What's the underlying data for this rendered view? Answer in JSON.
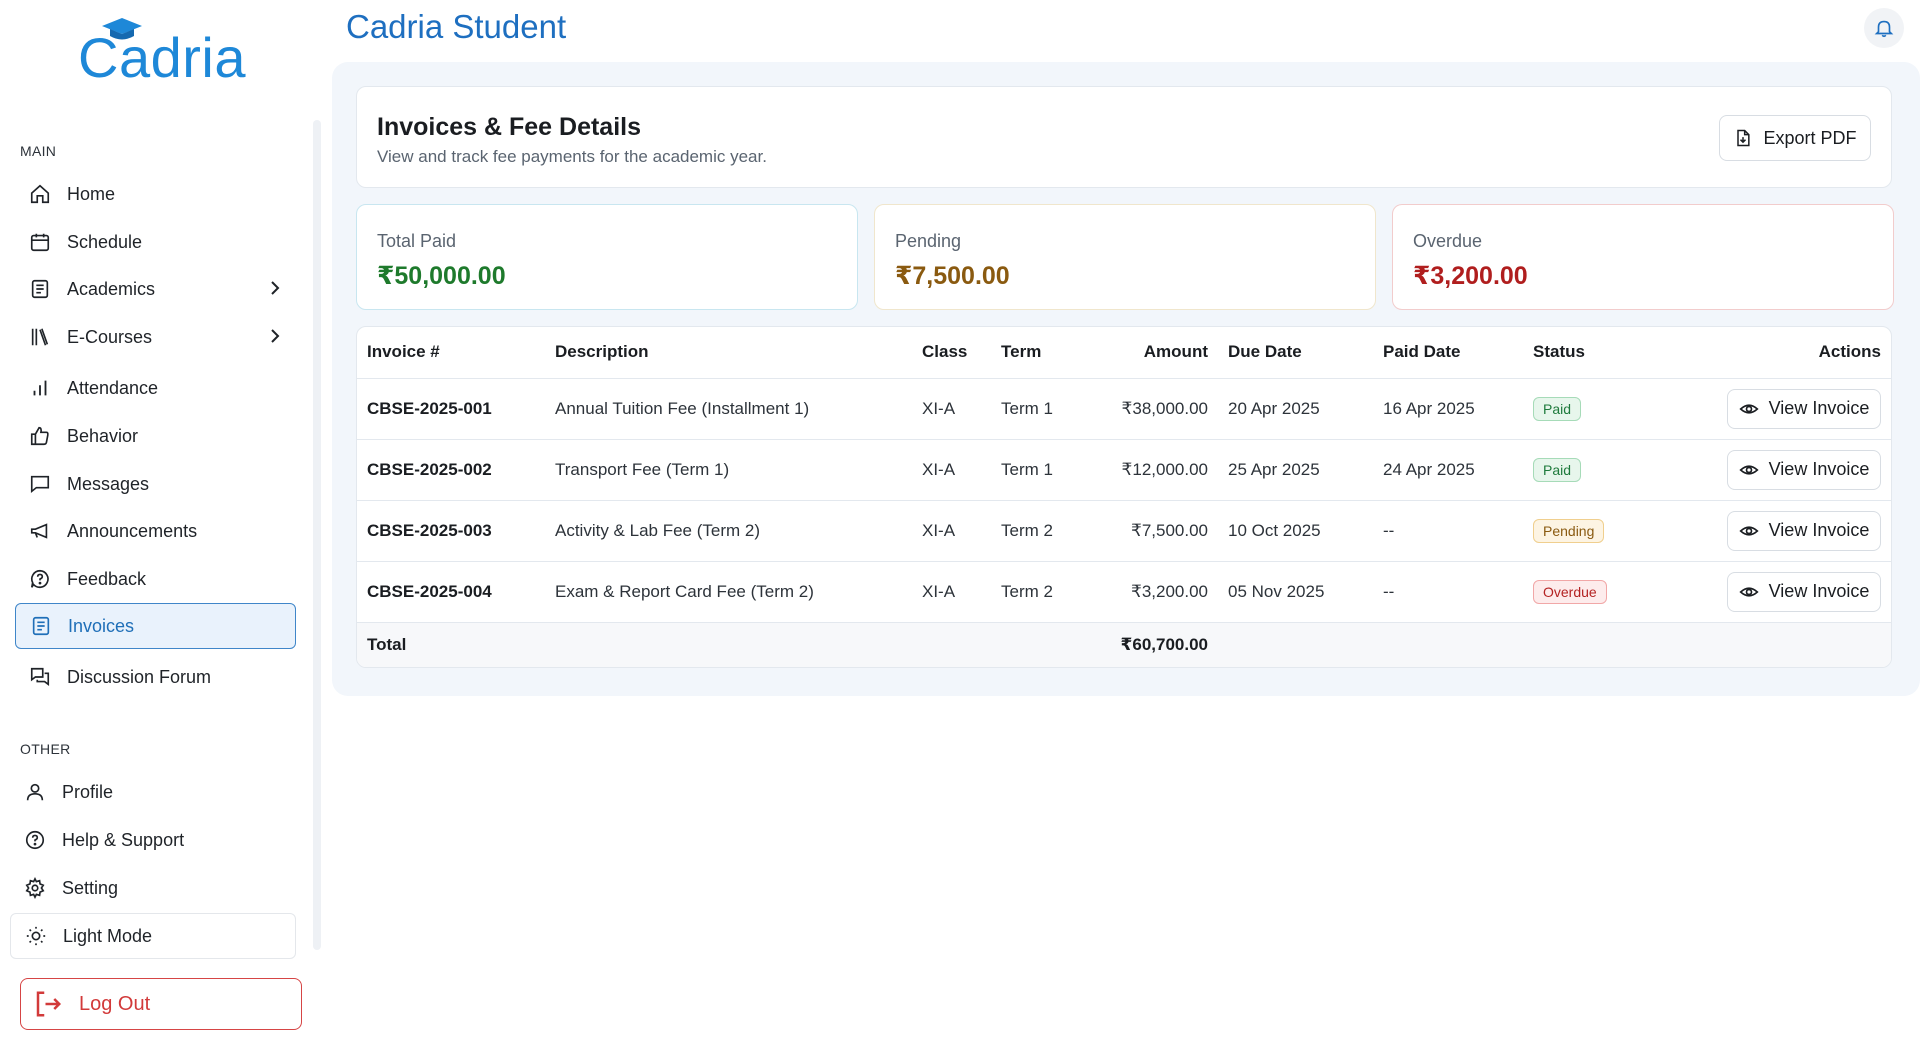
{
  "app": {
    "title": "Cadria Student",
    "logo_text": "Cadria"
  },
  "sidebar": {
    "main_label": "MAIN",
    "other_label": "OTHER",
    "items": [
      {
        "label": "Home",
        "icon": "home-icon"
      },
      {
        "label": "Schedule",
        "icon": "calendar-icon"
      },
      {
        "label": "Academics",
        "icon": "document-icon"
      },
      {
        "label": "E-Courses",
        "icon": "library-icon"
      },
      {
        "label": "Attendance",
        "icon": "bar-chart-icon"
      },
      {
        "label": "Behavior",
        "icon": "thumbs-up-icon"
      },
      {
        "label": "Messages",
        "icon": "message-icon"
      },
      {
        "label": "Announcements",
        "icon": "megaphone-icon"
      },
      {
        "label": "Feedback",
        "icon": "help-bubble-icon"
      },
      {
        "label": "Invoices",
        "icon": "invoice-icon"
      },
      {
        "label": "Discussion Forum",
        "icon": "forum-icon"
      }
    ],
    "other_items": [
      {
        "label": "Profile",
        "icon": "user-icon"
      },
      {
        "label": "Help & Support",
        "icon": "question-icon"
      },
      {
        "label": "Setting",
        "icon": "gear-icon"
      },
      {
        "label": "Light Mode",
        "icon": "sun-icon"
      }
    ],
    "logout_label": "Log Out"
  },
  "page": {
    "title": "Invoices & Fee Details",
    "subtitle": "View and track fee payments for the academic year.",
    "export_label": "Export PDF"
  },
  "stats": {
    "total_paid": {
      "label": "Total Paid",
      "value": "₹50,000.00",
      "color": "#1e7a2c"
    },
    "pending": {
      "label": "Pending",
      "value": "₹7,500.00",
      "color": "#8a5a10"
    },
    "overdue": {
      "label": "Overdue",
      "value": "₹3,200.00",
      "color": "#b01e1e"
    }
  },
  "table": {
    "headers": {
      "invoice": "Invoice #",
      "description": "Description",
      "class": "Class",
      "term": "Term",
      "amount": "Amount",
      "due_date": "Due Date",
      "paid_date": "Paid Date",
      "status": "Status",
      "actions": "Actions"
    },
    "action_label": "View Invoice",
    "rows": [
      {
        "invoice": "CBSE-2025-001",
        "description": "Annual Tuition Fee (Installment 1)",
        "class": "XI-A",
        "term": "Term 1",
        "amount": "₹38,000.00",
        "due_date": "20 Apr 2025",
        "paid_date": "16 Apr 2025",
        "status": "Paid"
      },
      {
        "invoice": "CBSE-2025-002",
        "description": "Transport Fee (Term 1)",
        "class": "XI-A",
        "term": "Term 1",
        "amount": "₹12,000.00",
        "due_date": "25 Apr 2025",
        "paid_date": "24 Apr 2025",
        "status": "Paid"
      },
      {
        "invoice": "CBSE-2025-003",
        "description": "Activity & Lab Fee (Term 2)",
        "class": "XI-A",
        "term": "Term 2",
        "amount": "₹7,500.00",
        "due_date": "10 Oct 2025",
        "paid_date": "--",
        "status": "Pending"
      },
      {
        "invoice": "CBSE-2025-004",
        "description": "Exam & Report Card Fee (Term 2)",
        "class": "XI-A",
        "term": "Term 2",
        "amount": "₹3,200.00",
        "due_date": "05 Nov 2025",
        "paid_date": "--",
        "status": "Overdue"
      }
    ],
    "total_label": "Total",
    "total_amount": "₹60,700.00"
  }
}
